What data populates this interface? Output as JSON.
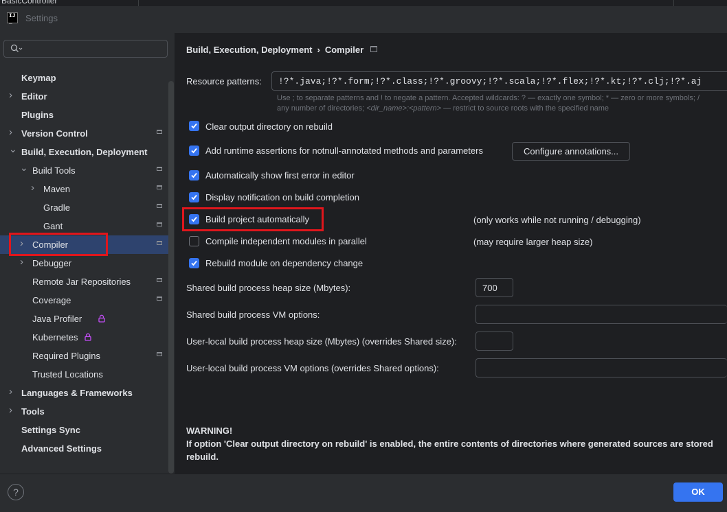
{
  "window": {
    "top_breadcrumb": "BasicController",
    "title": "Settings"
  },
  "sidebar": {
    "search": {
      "value": "",
      "placeholder": ""
    },
    "items": [
      {
        "label": "Keymap",
        "level": 0,
        "bold": true,
        "arrow": false,
        "project": false,
        "lock": false
      },
      {
        "label": "Editor",
        "level": 0,
        "bold": true,
        "arrow": true,
        "project": false,
        "lock": false
      },
      {
        "label": "Plugins",
        "level": 0,
        "bold": true,
        "arrow": false,
        "project": false,
        "lock": false
      },
      {
        "label": "Version Control",
        "level": 0,
        "bold": true,
        "arrow": true,
        "project": true,
        "lock": false
      },
      {
        "label": "Build, Execution, Deployment",
        "level": 0,
        "bold": true,
        "arrow": true,
        "expanded": true,
        "project": false,
        "lock": false
      },
      {
        "label": "Build Tools",
        "level": 1,
        "bold": false,
        "arrow": true,
        "expanded": true,
        "project": true,
        "lock": false
      },
      {
        "label": "Maven",
        "level": 2,
        "bold": false,
        "arrow": true,
        "project": true,
        "lock": false
      },
      {
        "label": "Gradle",
        "level": 2,
        "bold": false,
        "arrow": false,
        "project": true,
        "lock": false
      },
      {
        "label": "Gant",
        "level": 2,
        "bold": false,
        "arrow": false,
        "project": true,
        "lock": false
      },
      {
        "label": "Compiler",
        "level": 1,
        "bold": false,
        "arrow": true,
        "project": true,
        "lock": false,
        "selected": true
      },
      {
        "label": "Debugger",
        "level": 1,
        "bold": false,
        "arrow": true,
        "project": false,
        "lock": false
      },
      {
        "label": "Remote Jar Repositories",
        "level": 1,
        "bold": false,
        "arrow": false,
        "project": true,
        "lock": false
      },
      {
        "label": "Coverage",
        "level": 1,
        "bold": false,
        "arrow": false,
        "project": true,
        "lock": false
      },
      {
        "label": "Java Profiler",
        "level": 1,
        "bold": false,
        "arrow": false,
        "project": false,
        "lock": true
      },
      {
        "label": "Kubernetes",
        "level": 1,
        "bold": false,
        "arrow": false,
        "project": false,
        "lock": true
      },
      {
        "label": "Required Plugins",
        "level": 1,
        "bold": false,
        "arrow": false,
        "project": true,
        "lock": false
      },
      {
        "label": "Trusted Locations",
        "level": 1,
        "bold": false,
        "arrow": false,
        "project": false,
        "lock": false
      },
      {
        "label": "Languages & Frameworks",
        "level": 0,
        "bold": true,
        "arrow": true,
        "project": false,
        "lock": false
      },
      {
        "label": "Tools",
        "level": 0,
        "bold": true,
        "arrow": true,
        "project": false,
        "lock": false
      },
      {
        "label": "Settings Sync",
        "level": 0,
        "bold": true,
        "arrow": false,
        "project": false,
        "lock": false
      },
      {
        "label": "Advanced Settings",
        "level": 0,
        "bold": true,
        "arrow": false,
        "project": false,
        "lock": false
      }
    ]
  },
  "content": {
    "breadcrumb": {
      "parent": "Build, Execution, Deployment",
      "current": "Compiler"
    },
    "resource_patterns": {
      "label": "Resource patterns:",
      "value": "!?*.java;!?*.form;!?*.class;!?*.groovy;!?*.scala;!?*.flex;!?*.kt;!?*.clj;!?*.aj",
      "hint1": "Use ; to separate patterns and ! to negate a pattern. Accepted wildcards: ? — exactly one symbol; * — zero or more symbols; /",
      "hint2_prefix": "any number of directories; ",
      "hint2_pattern": "<dir_name>:<pattern>",
      "hint2_suffix": " — restrict to source roots with the specified name"
    },
    "options": {
      "clear_output": {
        "label": "Clear output directory on rebuild",
        "checked": true
      },
      "runtime_assertions": {
        "label": "Add runtime assertions for notnull-annotated methods and parameters",
        "checked": true
      },
      "configure_annotations": "Configure annotations...",
      "show_first_error": {
        "label": "Automatically show first error in editor",
        "checked": true
      },
      "display_notification": {
        "label": "Display notification on build completion",
        "checked": true
      },
      "build_automatically": {
        "label": "Build project automatically",
        "checked": true,
        "note": "(only works while not running / debugging)"
      },
      "compile_parallel": {
        "label": "Compile independent modules in parallel",
        "checked": false,
        "note": "(may require larger heap size)"
      },
      "rebuild_dependency": {
        "label": "Rebuild module on dependency change",
        "checked": true
      }
    },
    "fields": {
      "shared_heap": {
        "label": "Shared build process heap size (Mbytes):",
        "value": "700"
      },
      "shared_vm": {
        "label": "Shared build process VM options:",
        "value": ""
      },
      "user_heap": {
        "label": "User-local build process heap size (Mbytes) (overrides Shared size):",
        "value": ""
      },
      "user_vm": {
        "label": "User-local build process VM options (overrides Shared options):",
        "value": ""
      }
    },
    "warning": {
      "title": "WARNING!",
      "line1": "If option 'Clear output directory on rebuild' is enabled, the entire contents of directories where generated sources are stored",
      "line2": "rebuild."
    }
  },
  "footer": {
    "help": "?",
    "ok": "OK"
  },
  "colors": {
    "accent": "#3574f0",
    "selection": "#2e436e",
    "highlight": "#e0161c",
    "lock": "#c24df5"
  }
}
